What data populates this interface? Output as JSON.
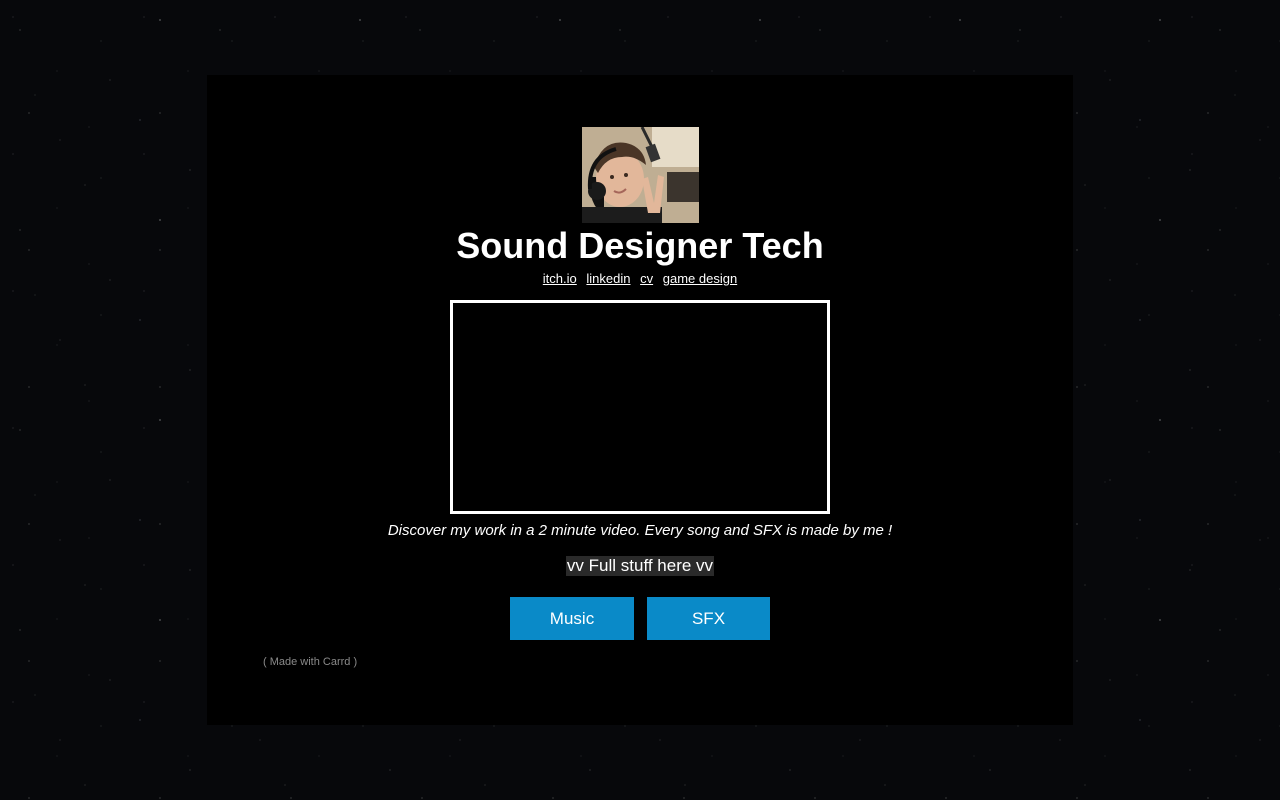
{
  "profile": {
    "title": "Sound Designer Tech"
  },
  "links": [
    {
      "label": "itch.io"
    },
    {
      "label": "linkedin"
    },
    {
      "label": "cv"
    },
    {
      "label": "game design"
    }
  ],
  "video": {
    "caption": "Discover my work in a 2 minute video. Every song and SFX is made by me !"
  },
  "highlight": {
    "text": "vv Full stuff here vv"
  },
  "buttons": {
    "music_label": "Music",
    "sfx_label": "SFX"
  },
  "footer": {
    "text": "( Made with Carrd )"
  },
  "colors": {
    "page_background": "#07080b",
    "card_background": "#000000",
    "button": "#0a8ac8",
    "text": "#ffffff",
    "footer_text": "#8a8a8a"
  }
}
